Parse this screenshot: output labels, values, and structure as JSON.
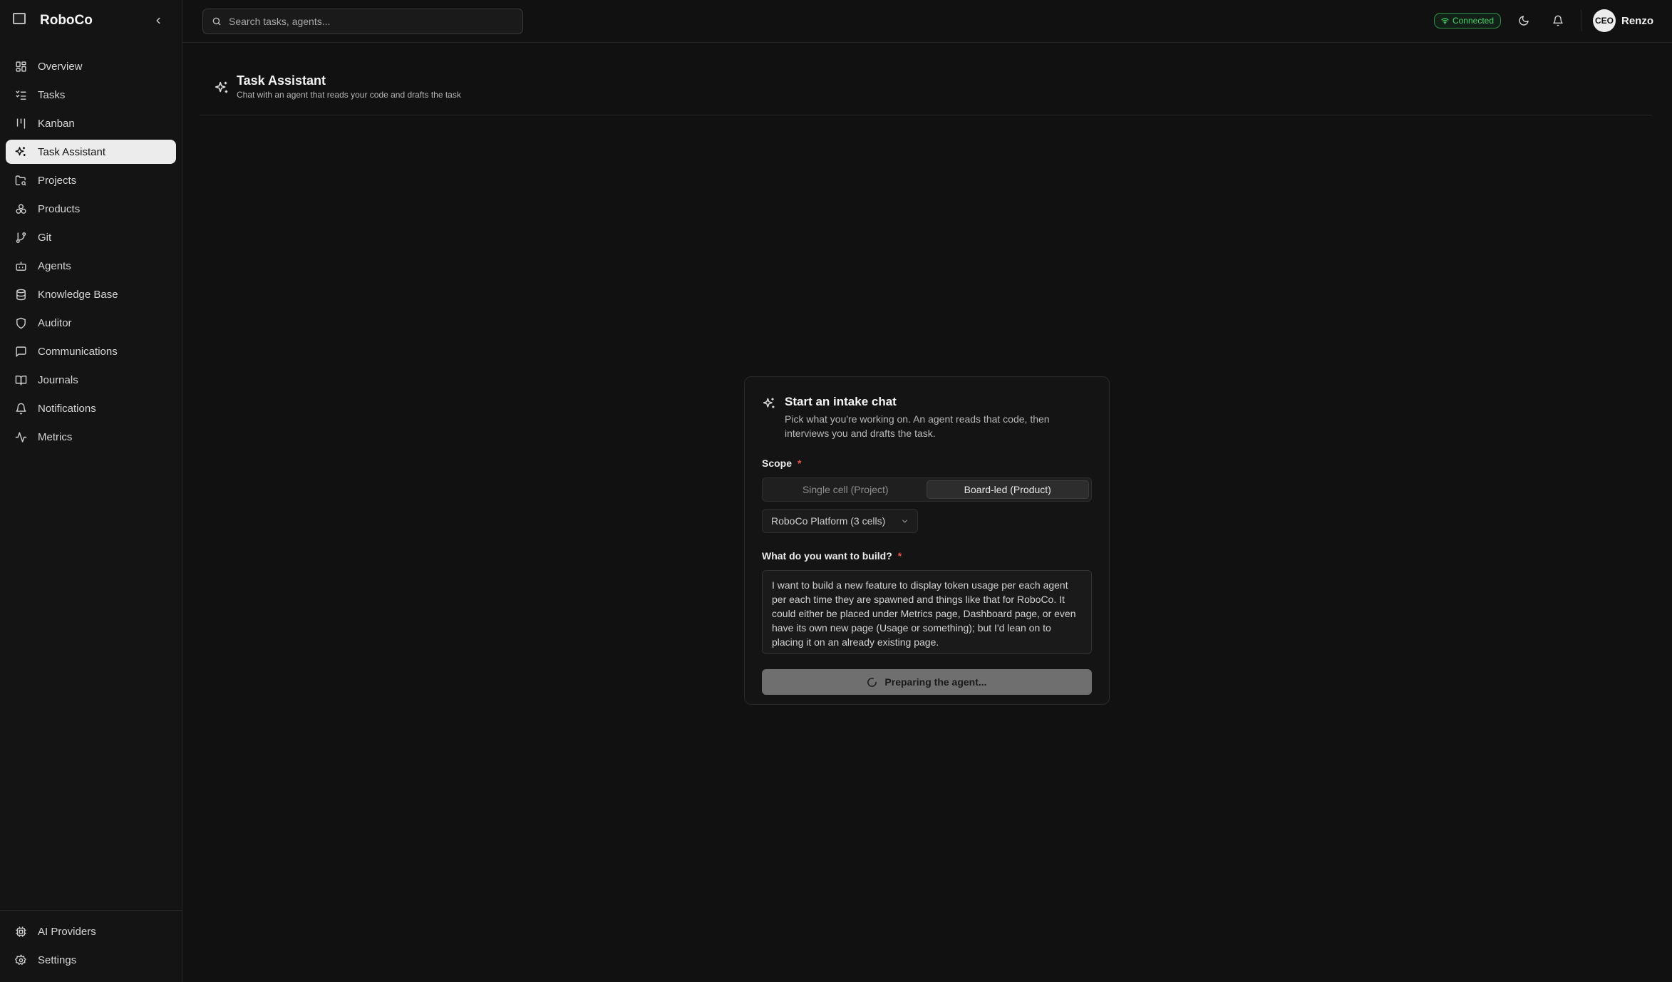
{
  "brand": {
    "name": "RoboCo"
  },
  "sidebar": {
    "items": [
      {
        "label": "Overview",
        "icon": "layout-grid-icon",
        "active": false
      },
      {
        "label": "Tasks",
        "icon": "list-checks-icon",
        "active": false
      },
      {
        "label": "Kanban",
        "icon": "kanban-icon",
        "active": false
      },
      {
        "label": "Task Assistant",
        "icon": "sparkles-icon",
        "active": true
      },
      {
        "label": "Projects",
        "icon": "folder-search-icon",
        "active": false
      },
      {
        "label": "Products",
        "icon": "boxes-icon",
        "active": false
      },
      {
        "label": "Git",
        "icon": "git-branch-icon",
        "active": false
      },
      {
        "label": "Agents",
        "icon": "bot-icon",
        "active": false
      },
      {
        "label": "Knowledge Base",
        "icon": "database-icon",
        "active": false
      },
      {
        "label": "Auditor",
        "icon": "shield-icon",
        "active": false
      },
      {
        "label": "Communications",
        "icon": "message-square-icon",
        "active": false
      },
      {
        "label": "Journals",
        "icon": "book-open-icon",
        "active": false
      },
      {
        "label": "Notifications",
        "icon": "bell-icon",
        "active": false
      },
      {
        "label": "Metrics",
        "icon": "activity-icon",
        "active": false
      }
    ],
    "bottom": [
      {
        "label": "AI Providers",
        "icon": "cpu-icon"
      },
      {
        "label": "Settings",
        "icon": "gear-icon"
      }
    ]
  },
  "topbar": {
    "search_placeholder": "Search tasks, agents...",
    "status": "Connected",
    "avatar_initials": "CEO",
    "user_name": "Renzo"
  },
  "page": {
    "title": "Task Assistant",
    "subtitle": "Chat with an agent that reads your code and drafts the task"
  },
  "card": {
    "title": "Start an intake chat",
    "description": "Pick what you're working on. An agent reads that code, then interviews you and drafts the task.",
    "scope_label": "Scope",
    "required_mark": "*",
    "scope_options": [
      "Single cell (Project)",
      "Board-led (Product)"
    ],
    "scope_selected": "Board-led (Product)",
    "product_select": "RoboCo Platform (3 cells)",
    "build_label": "What do you want to build?",
    "build_value": "I want to build a new feature to display token usage per each agent per each time they are spawned and things like that for RoboCo. It could either be placed under Metrics page, Dashboard page, or even have its own new page (Usage or something); but I'd lean on to placing it on an already existing page.",
    "submit_label": "Preparing the agent..."
  },
  "colors": {
    "background": "#111111",
    "sidebar": "#141414",
    "connected_green": "#4ad36a",
    "required_red": "#e5534b",
    "active_nav": "#ececec"
  }
}
